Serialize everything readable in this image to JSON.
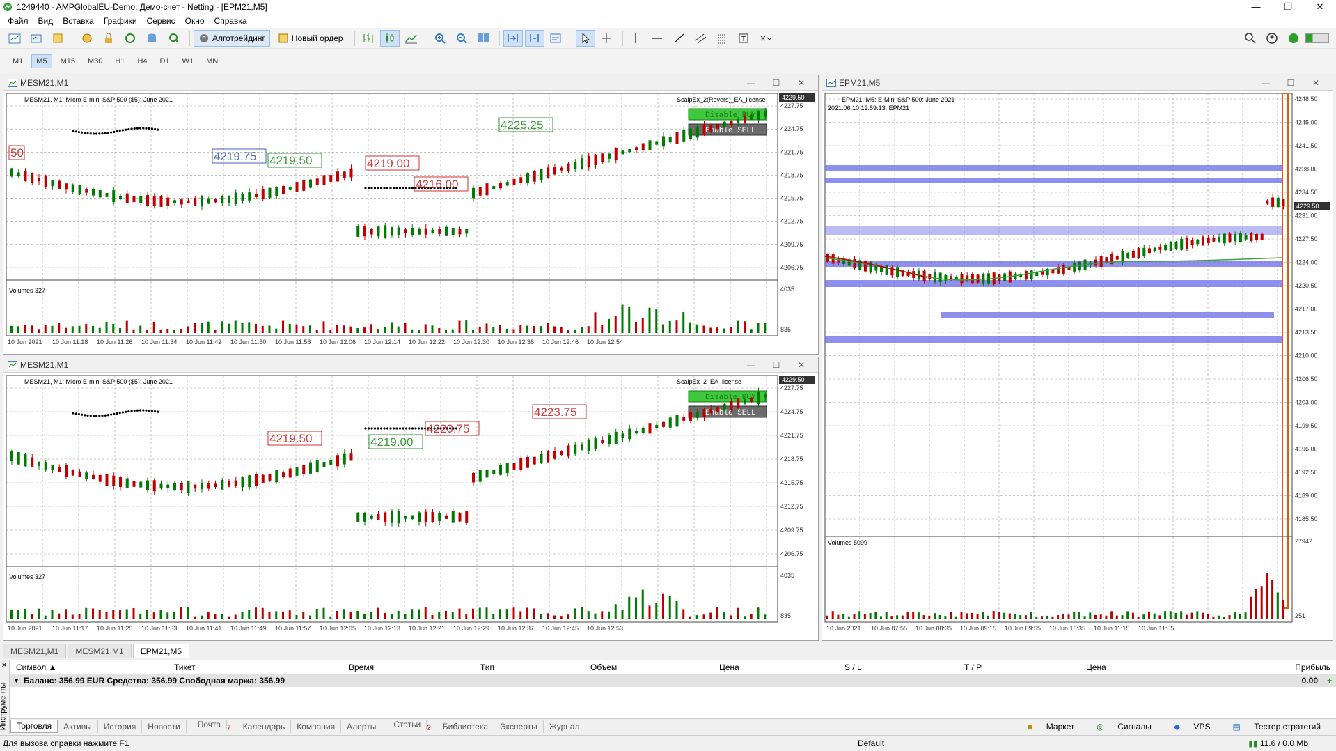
{
  "title": "1249440 - AMPGlobalEU-Demo: Демо-счет - Netting - [EPM21,M5]",
  "menu": [
    "Файл",
    "Вид",
    "Вставка",
    "Графики",
    "Сервис",
    "Окно",
    "Справка"
  ],
  "toolbar": {
    "algo": "Алготрейдинг",
    "neworder": "Новый ордер"
  },
  "timeframes": [
    "M1",
    "M5",
    "M15",
    "M30",
    "H1",
    "H4",
    "D1",
    "W1",
    "MN"
  ],
  "active_timeframe": "M5",
  "chart1": {
    "tab": "MESM21,M1",
    "label": "MESM21, M1:  Micro E-mini S&P 500 ($5): June 2021",
    "ea": "ScalpEx_2(Revers)_EA_license",
    "btn_buy": "Disable BUY",
    "btn_sell": "Enable SELL",
    "price_tag": "4229.50",
    "prices": [
      "4227.75",
      "4224.75",
      "4221.75",
      "4218.75",
      "4215.75",
      "4212.75",
      "4209.75",
      "4206.75"
    ],
    "vol_label": "Volumes 327",
    "vol_ticks": [
      "4035",
      "835"
    ],
    "times": [
      "10 Jun 2021",
      "10 Jun 11:18",
      "10 Jun 11:26",
      "10 Jun 11:34",
      "10 Jun 11:42",
      "10 Jun 11:50",
      "10 Jun 11:58",
      "10 Jun 12:06",
      "10 Jun 12:14",
      "10 Jun 12:22",
      "10 Jun 12:30",
      "10 Jun 12:38",
      "10 Jun 12:46",
      "10 Jun 12:54"
    ],
    "labels": [
      "50",
      "4219.75",
      "4219.50",
      "4219.00",
      "4216.00",
      "4225.25"
    ]
  },
  "chart2": {
    "tab": "MESM21,M1",
    "label": "MESM21, M1:  Micro E-mini S&P 500 ($5): June 2021",
    "ea": "ScalpEx_2_EA_license",
    "btn_buy": "Disable BUY",
    "btn_sell": "Enable SELL",
    "price_tag": "4229.50",
    "prices": [
      "4227.75",
      "4224.75",
      "4221.75",
      "4218.75",
      "4215.75",
      "4212.75",
      "4209.75",
      "4206.75"
    ],
    "vol_label": "Volumes 327",
    "vol_ticks": [
      "4035",
      "835"
    ],
    "times": [
      "10 Jun 2021",
      "10 Jun 11:17",
      "10 Jun 11:25",
      "10 Jun 11:33",
      "10 Jun 11:41",
      "10 Jun 11:49",
      "10 Jun 11:57",
      "10 Jun 12:05",
      "10 Jun 12:13",
      "10 Jun 12:21",
      "10 Jun 12:29",
      "10 Jun 12:37",
      "10 Jun 12:45",
      "10 Jun 12:53"
    ],
    "labels": [
      "4219.50",
      "4219.00",
      "4220.75",
      "4223.75"
    ]
  },
  "chart3": {
    "tab": "EPM21,M5",
    "label": "EPM21, M5:  E-Mini S&P 500: June 2021",
    "sub": "2021.06.10 12:59:13: EPM21",
    "price_tag": "4229.50",
    "prices": [
      "4248.50",
      "4245.00",
      "4241.50",
      "4238.00",
      "4234.50",
      "4231.00",
      "4227.50",
      "4224.00",
      "4220.50",
      "4217.00",
      "4213.50",
      "4210.00",
      "4206.50",
      "4203.00",
      "4199.50",
      "4196.00",
      "4192.50",
      "4189.00",
      "4185.50"
    ],
    "vol_label": "Volumes 5099",
    "vol_ticks": [
      "27942",
      "251"
    ],
    "times": [
      "10 Jun 2021",
      "10 Jun 07:55",
      "10 Jun 08:35",
      "10 Jun 09:15",
      "10 Jun 09:55",
      "10 Jun 10:35",
      "10 Jun 11:15",
      "10 Jun 11:55"
    ]
  },
  "tabs": [
    "MESM21,M1",
    "MESM21,M1",
    "EPM21,M5"
  ],
  "active_tab": 2,
  "table": {
    "cols": [
      "Символ",
      "Тикет",
      "Время",
      "Тип",
      "Объем",
      "Цена",
      "S / L",
      "T / P",
      "Цена",
      "Прибыль"
    ],
    "balance": "Баланс: 356.99 EUR  Средства: 356.99  Свободная маржа: 356.99",
    "profit": "0.00"
  },
  "side_label": "Инструменты",
  "bottom_tabs": [
    "Торговля",
    "Активы",
    "История",
    "Новости",
    "Почта",
    "Календарь",
    "Компания",
    "Алерты",
    "Статьи",
    "Библиотека",
    "Эксперты",
    "Журнал"
  ],
  "mail_badge": "7",
  "articles_badge": "2",
  "bottom_right": [
    "Маркет",
    "Сигналы",
    "VPS",
    "Тестер стратегий"
  ],
  "status": {
    "help": "Для вызова справки нажмите F1",
    "profile": "Default",
    "net": "11.6 / 0.0 Mb"
  },
  "colors": {
    "bull": "#007a00",
    "bear": "#c00000",
    "accent": "#0050c8"
  }
}
